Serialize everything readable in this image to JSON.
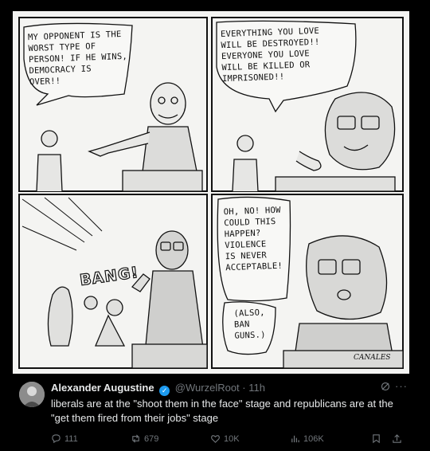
{
  "comic": {
    "panel1": {
      "speech": [
        "MY OPPONENT IS THE",
        "WORST TYPE OF",
        "PERSON! IF HE WINS,",
        "DEMOCRACY IS",
        "OVER!!"
      ]
    },
    "panel2": {
      "speech": [
        "EVERYTHING YOU LOVE",
        "WILL BE DESTROYED!!",
        "EVERYONE YOU LOVE",
        "WILL BE KILLED OR",
        "IMPRISONED!!"
      ]
    },
    "panel3": {
      "sfx": "BANG!"
    },
    "panel4": {
      "speech": [
        "OH, NO! HOW",
        "COULD THIS",
        "HAPPEN?",
        "VIOLENCE",
        "IS NEVER",
        "ACCEPTABLE!"
      ],
      "aside": [
        "(ALSO,",
        "BAN",
        "GUNS.)"
      ]
    },
    "signature": "CANALES"
  },
  "tweet": {
    "author": "Alexander Augustine",
    "handle": "@WurzelRoot",
    "separator": "·",
    "time": "11h",
    "text": "liberals are at the \"shoot them in the face\" stage and republicans are at the \"get them fired from their jobs\" stage",
    "replies": "111",
    "reposts": "679",
    "likes": "10K",
    "views": "106K",
    "icons": [
      "verified-icon",
      "grok-icon",
      "more-icon",
      "reply-icon",
      "repost-icon",
      "like-icon",
      "views-icon",
      "bookmark-icon",
      "share-icon"
    ]
  }
}
